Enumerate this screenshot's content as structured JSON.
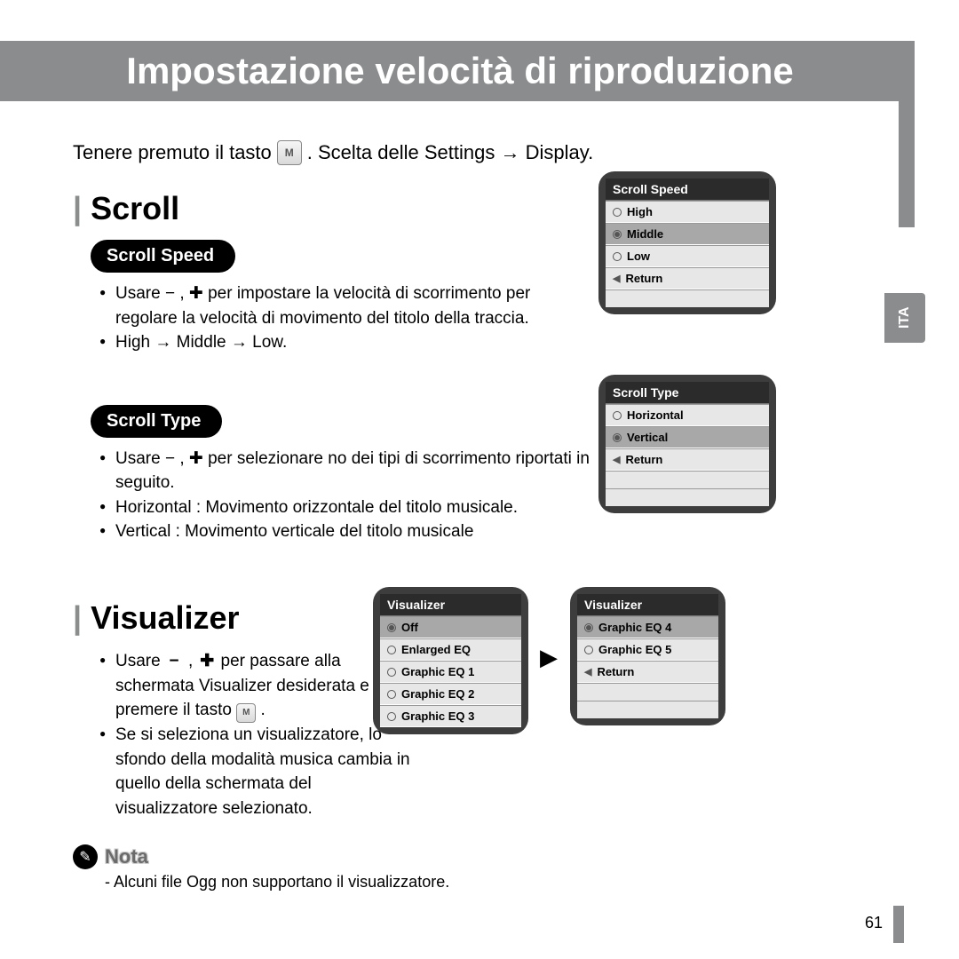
{
  "page": {
    "title": "Impostazione velocità di riproduzione",
    "side_tab": "ITA",
    "page_number": "61"
  },
  "intro": {
    "before_btn": "Tenere premuto il tasto",
    "btn_label": "M",
    "after_btn": ". Scelta delle Settings → Display."
  },
  "scroll": {
    "heading": "Scroll",
    "speed": {
      "pill": "Scroll Speed",
      "bullets": [
        "Usare  − , ✚  per impostare la velocità di scorrimento per regolare la velocità di movimento del titolo della traccia.",
        "High → Middle → Low."
      ],
      "menu": {
        "title": "Scroll Speed",
        "options": [
          "High",
          "Middle",
          "Low"
        ],
        "return_label": "Return",
        "selected": "Middle",
        "empties": 1
      }
    },
    "type": {
      "pill": "Scroll Type",
      "bullets": [
        "Usare  − , ✚ per selezionare no dei tipi di scorrimento riportati in seguito.",
        "Horizontal : Movimento orizzontale del titolo musicale.",
        "Vertical : Movimento verticale del titolo musicale"
      ],
      "menu": {
        "title": "Scroll Type",
        "options": [
          "Horizontal",
          "Vertical"
        ],
        "return_label": "Return",
        "selected": "Vertical",
        "empties": 2
      }
    }
  },
  "visualizer": {
    "heading": "Visualizer",
    "bullets_html": [
      "Usare  − , ✚  per passare alla schermata Visualizer desiderata e premere il tasto  .",
      "Se si seleziona un visualizzatore, lo sfondo della modalità musica cambia in quello della schermata del visualizzatore selezionato."
    ],
    "menu1": {
      "title": "Visualizer",
      "options": [
        "Off",
        "Enlarged EQ",
        "Graphic EQ 1",
        "Graphic EQ 2",
        "Graphic EQ 3"
      ],
      "selected": "Off"
    },
    "menu2": {
      "title": "Visualizer",
      "options": [
        "Graphic EQ 4",
        "Graphic EQ 5"
      ],
      "return_label": "Return",
      "selected": "Graphic EQ 4",
      "empties": 2
    },
    "nota_label": "Nota",
    "nota_text": "- Alcuni file Ogg non supportano il visualizzatore."
  }
}
